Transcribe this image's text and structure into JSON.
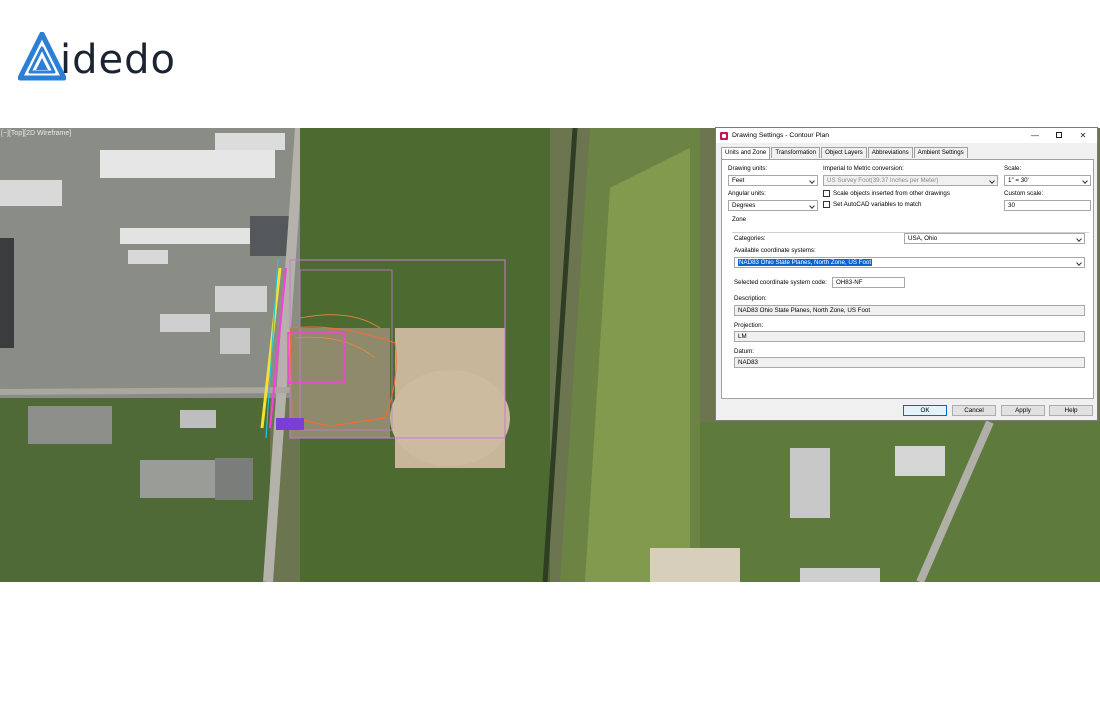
{
  "logo": {
    "text": "idedo",
    "icon": "aidedo-triangle-logo",
    "color": "#2b7fd4"
  },
  "viewport": {
    "label": "[−][Top][2D Wireframe]"
  },
  "dialog": {
    "title": "Drawing Settings - Contour Plan",
    "icon": "drawing-settings-icon",
    "window_buttons": {
      "minimize": "—",
      "maximize": "□",
      "close": "✕"
    },
    "tabs": [
      {
        "label": "Units and Zone",
        "active": true
      },
      {
        "label": "Transformation",
        "active": false
      },
      {
        "label": "Object Layers",
        "active": false
      },
      {
        "label": "Abbreviations",
        "active": false
      },
      {
        "label": "Ambient Settings",
        "active": false
      }
    ],
    "drawing_units": {
      "label": "Drawing units:",
      "value": "Feet"
    },
    "imperial_to_metric": {
      "label": "Imperial to Metric conversion:",
      "value": "US Survey Foot(39.37 Inches per Meter)"
    },
    "scale": {
      "label": "Scale:",
      "value": "1\" = 30'"
    },
    "angular_units": {
      "label": "Angular units:",
      "value": "Degrees"
    },
    "scale_objects_checkbox": {
      "label": "Scale objects inserted from other drawings",
      "checked": false
    },
    "set_autocad_checkbox": {
      "label": "Set AutoCAD variables to match",
      "checked": false
    },
    "custom_scale": {
      "label": "Custom scale:",
      "value": "30"
    },
    "zone": {
      "label": "Zone",
      "categories": {
        "label": "Categories:",
        "value": "USA, Ohio"
      },
      "available_systems": {
        "label": "Available coordinate systems:",
        "value": "NAD83 Ohio State Planes, North Zone, US Foot"
      },
      "selected_code": {
        "label": "Selected coordinate system code:",
        "value": "OH83-NF"
      },
      "description": {
        "label": "Description:",
        "value": "NAD83 Ohio State Planes, North Zone, US Foot"
      },
      "projection": {
        "label": "Projection:",
        "value": "LM"
      },
      "datum": {
        "label": "Datum:",
        "value": "NAD83"
      }
    },
    "buttons": {
      "ok": "OK",
      "cancel": "Cancel",
      "apply": "Apply",
      "help": "Help"
    }
  }
}
